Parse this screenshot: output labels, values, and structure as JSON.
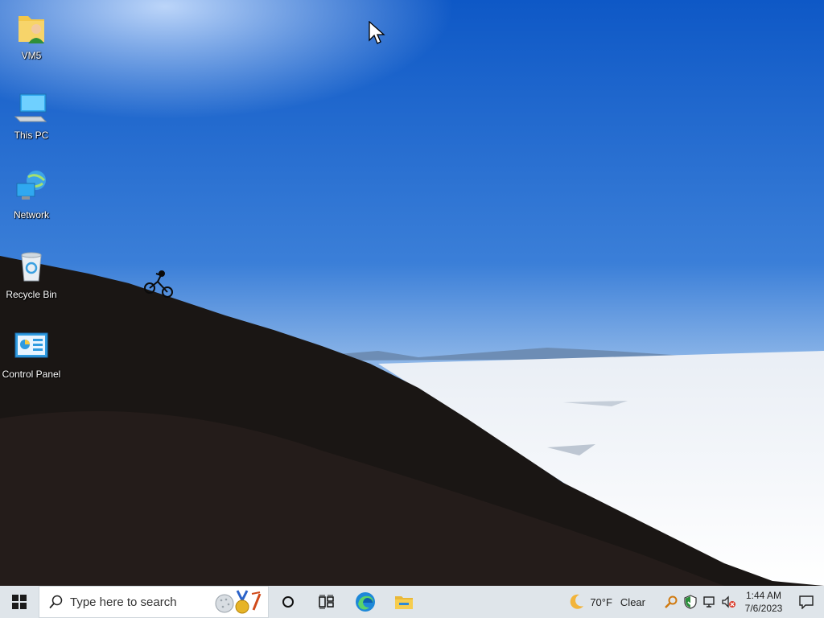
{
  "desktop": {
    "icons": [
      {
        "label": "VM5",
        "icon": "user-folder-icon"
      },
      {
        "label": "This PC",
        "icon": "computer-icon"
      },
      {
        "label": "Network",
        "icon": "network-icon"
      },
      {
        "label": "Recycle Bin",
        "icon": "recycle-bin-icon"
      },
      {
        "label": "Control Panel",
        "icon": "control-panel-icon"
      }
    ]
  },
  "taskbar": {
    "search_placeholder": "Type here to search",
    "pinned": [
      {
        "name": "cortana-button",
        "icon": "circle-icon"
      },
      {
        "name": "task-view-button",
        "icon": "task-view-icon"
      },
      {
        "name": "edge-button",
        "icon": "edge-icon"
      },
      {
        "name": "file-explorer-button",
        "icon": "folder-icon"
      }
    ],
    "weather": {
      "temp": "70°F",
      "condition": "Clear",
      "icon": "moon-icon"
    },
    "clock": {
      "time": "1:44 AM",
      "date": "7/6/2023"
    }
  },
  "colors": {
    "taskbar_bg": "#dfe5ea",
    "sky_top": "#0d57c8",
    "sky_bottom": "#8fb8e8"
  }
}
